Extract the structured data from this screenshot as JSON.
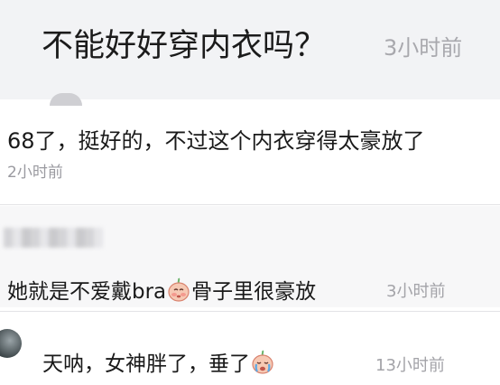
{
  "post": {
    "title": "不能好好穿内衣吗？",
    "time": "3小时前"
  },
  "comments": [
    {
      "text": "68了，挺好的，不过这个内衣穿得太豪放了",
      "time": "2小时前"
    },
    {
      "text_before": "她就是不爱戴bra",
      "emoji_icon": "blushing-face-emoji-icon",
      "text_after": "骨子里很豪放",
      "time": "3小时前"
    },
    {
      "text": "天呐，女神胖了，垂了",
      "emoji_icon": "crying-face-emoji-icon",
      "time": "13小时前"
    }
  ]
}
